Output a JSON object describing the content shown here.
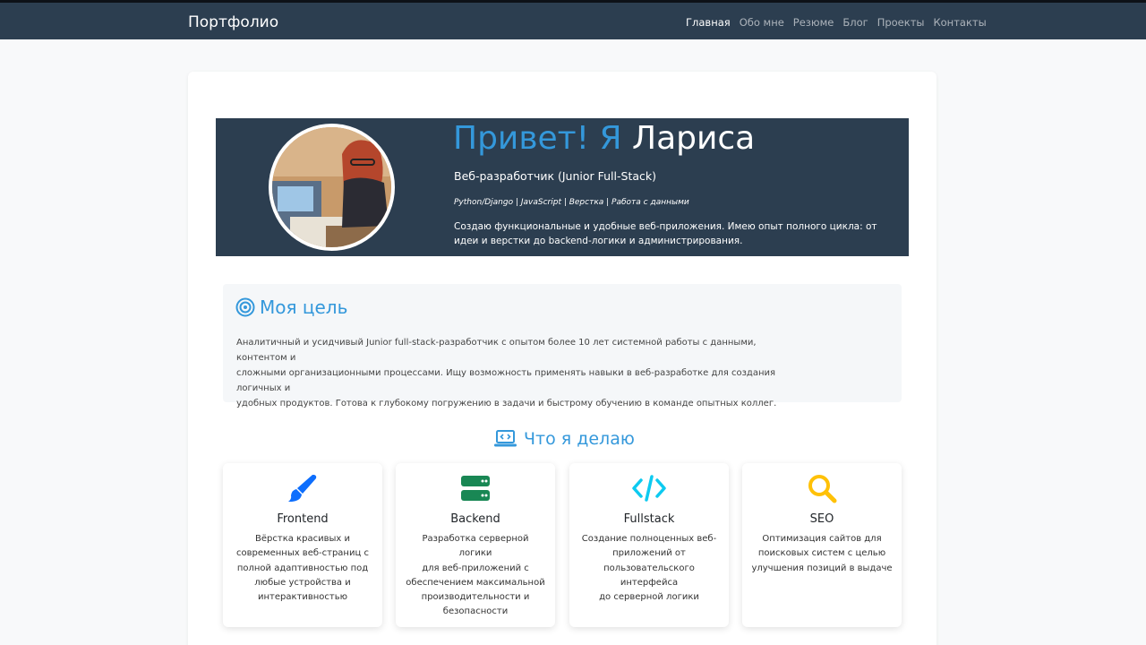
{
  "navbar": {
    "brand": "Портфолио",
    "links": [
      {
        "label": "Главная",
        "active": true
      },
      {
        "label": "Обо мне"
      },
      {
        "label": "Резюме"
      },
      {
        "label": "Блог"
      },
      {
        "label": "Проекты"
      },
      {
        "label": "Контакты"
      }
    ]
  },
  "hero": {
    "greeting": "Привет! Я",
    "name": "Лариса",
    "subtitle": "Веб-разработчик (Junior Full-Stack)",
    "tags": "Python/Django | JavaScript | Верстка | Работа с данными",
    "description": "Создаю функциональные и удобные веб-приложения. Имею опыт полного цикла: от идеи и верстки до backend-логики и администрирования.",
    "avatar_icon": "profile-photo"
  },
  "goal": {
    "icon": "bullseye-icon",
    "title": "Моя цель",
    "text_lines": [
      "Аналитичный и усидчивый Junior full-stack-разработчик с опытом более 10 лет системной работы с данными, контентом и",
      "сложными организационными процессами. Ищу возможность применять навыки в веб-разработке для создания логичных и",
      "удобных продуктов. Готова к глубокому погружению в задачи и быстрому обучению в команде опытных коллег."
    ]
  },
  "services": {
    "icon": "laptop-code-icon",
    "title": "Что я делаю",
    "items": [
      {
        "title": "Frontend",
        "icon": "brush-icon",
        "color": "#0d6efd",
        "lines": [
          "Вёрстка красивых и",
          "современных веб-страниц с",
          "полной адаптивностью под",
          "любые устройства и",
          "интерактивностью"
        ]
      },
      {
        "title": "Backend",
        "icon": "server-icon",
        "color": "#198754",
        "lines": [
          "Разработка серверной логики",
          "для веб-приложений с",
          "обеспечением максимальной",
          "производительности и",
          "безопасности"
        ]
      },
      {
        "title": "Fullstack",
        "icon": "code-icon",
        "color": "#0dcaf0",
        "lines": [
          "Создание полноценных веб-",
          "приложений от",
          "пользовательского интерфейса",
          "до серверной логики"
        ]
      },
      {
        "title": "SEO",
        "icon": "search-icon",
        "color": "#ffc107",
        "lines": [
          "Оптимизация сайтов для",
          "поисковых систем с целью",
          "улучшения позиций в выдаче"
        ]
      }
    ]
  },
  "colors": {
    "navbar_bg": "#2c3e50",
    "accent": "#3498db",
    "hero_bg": "#2c3e50"
  }
}
